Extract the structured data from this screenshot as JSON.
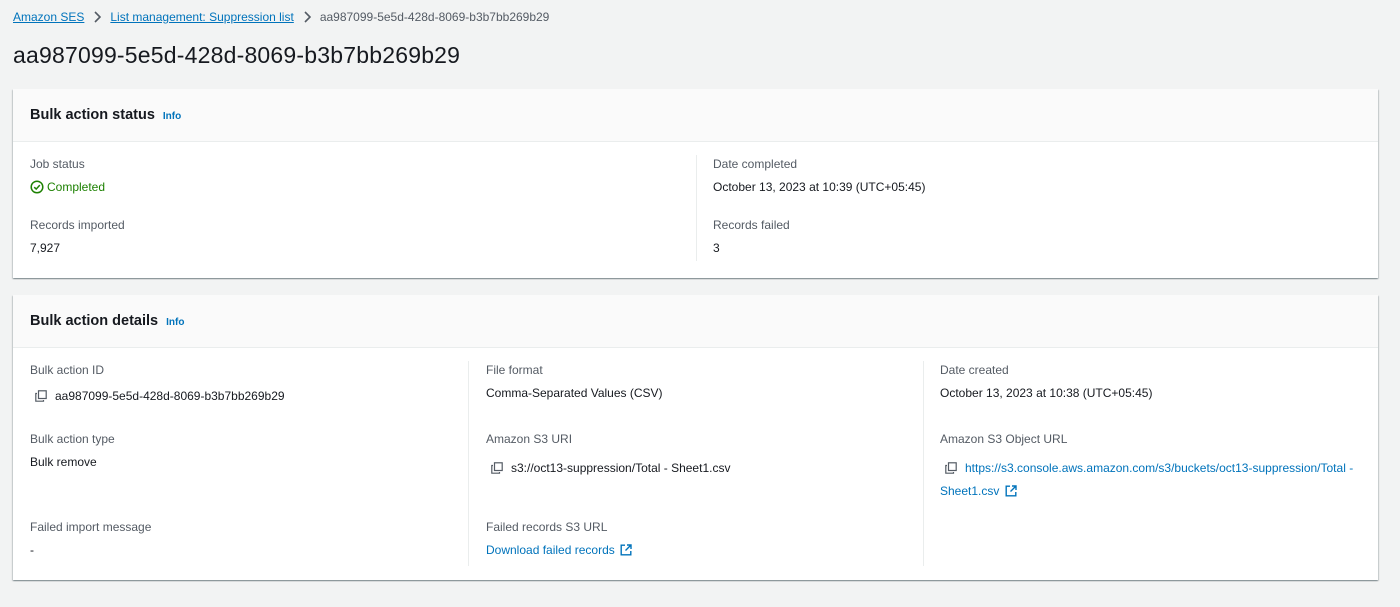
{
  "breadcrumb": {
    "items": [
      {
        "label": "Amazon SES"
      },
      {
        "label": "List management: Suppression list"
      }
    ],
    "current": "aa987099-5e5d-428d-8069-b3b7bb269b29"
  },
  "page_title": "aa987099-5e5d-428d-8069-b3b7bb269b29",
  "status_panel": {
    "title": "Bulk action status",
    "info": "Info",
    "job_status_label": "Job status",
    "job_status_value": "Completed",
    "date_completed_label": "Date completed",
    "date_completed_value": "October 13, 2023 at 10:39 (UTC+05:45)",
    "records_imported_label": "Records imported",
    "records_imported_value": "7,927",
    "records_failed_label": "Records failed",
    "records_failed_value": "3"
  },
  "details_panel": {
    "title": "Bulk action details",
    "info": "Info",
    "bulk_action_id_label": "Bulk action ID",
    "bulk_action_id_value": "aa987099-5e5d-428d-8069-b3b7bb269b29",
    "file_format_label": "File format",
    "file_format_value": "Comma-Separated Values (CSV)",
    "date_created_label": "Date created",
    "date_created_value": "October 13, 2023 at 10:38 (UTC+05:45)",
    "bulk_action_type_label": "Bulk action type",
    "bulk_action_type_value": "Bulk remove",
    "s3_uri_label": "Amazon S3 URI",
    "s3_uri_value": "s3://oct13-suppression/Total - Sheet1.csv",
    "s3_object_url_label": "Amazon S3 Object URL",
    "s3_object_url_line1": "https://s3.console.aws.amazon.com/s3/buckets/oct13-suppression/Total -",
    "s3_object_url_line2": "Sheet1.csv",
    "failed_import_message_label": "Failed import message",
    "failed_import_message_value": "-",
    "failed_records_s3_url_label": "Failed records S3 URL",
    "failed_records_s3_url_value": "Download failed records"
  },
  "icons": {
    "breadcrumb_separator": "chevron-right-icon",
    "status": "check-circle-icon",
    "copy": "copy-icon",
    "external": "external-link-icon"
  },
  "colors": {
    "link": "#0073bb",
    "success": "#1d8102",
    "background": "#f2f3f3",
    "panel_header": "#fafafa"
  }
}
